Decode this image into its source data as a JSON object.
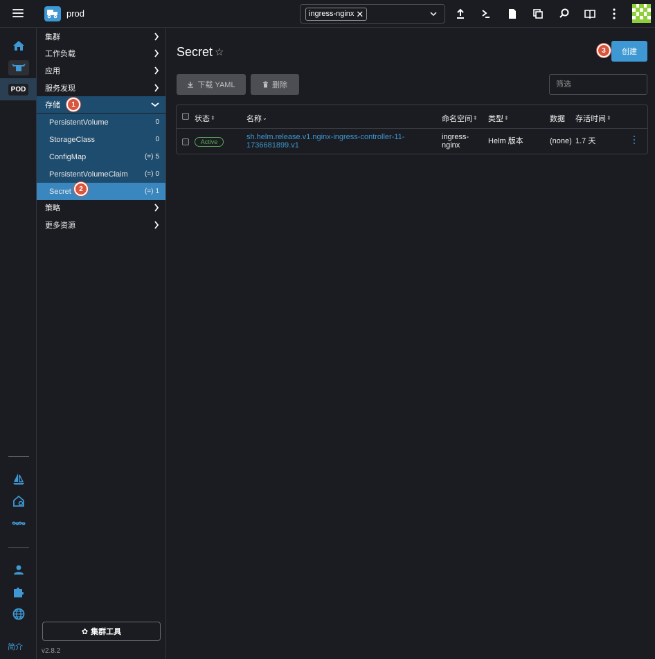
{
  "header": {
    "cluster_name": "prod",
    "namespace_chip": "ingress-nginx",
    "icons": [
      "upload-icon",
      "terminal-icon",
      "file-icon",
      "copy-icon",
      "search-icon",
      "book-icon",
      "kebab-icon"
    ]
  },
  "rail": {
    "pod_label": "POD",
    "bottom_label": "简介"
  },
  "sidenav": {
    "groups": [
      {
        "label": "集群"
      },
      {
        "label": "工作负载"
      },
      {
        "label": "应用"
      },
      {
        "label": "服务发现"
      },
      {
        "label": "存储"
      },
      {
        "label": "策略"
      },
      {
        "label": "更多资源"
      }
    ],
    "storage_items": [
      {
        "label": "PersistentVolume",
        "count": "0"
      },
      {
        "label": "StorageClass",
        "count": "0"
      },
      {
        "label": "ConfigMap",
        "count": "5"
      },
      {
        "label": "PersistentVolumeClaim",
        "count": "0"
      },
      {
        "label": "Secret",
        "count": "1"
      }
    ],
    "callouts": [
      "1",
      "2",
      "3"
    ],
    "cluster_tools": "集群工具",
    "version": "v2.8.2"
  },
  "main": {
    "title": "Secret",
    "create_label": "创建",
    "download_label": "下载 YAML",
    "delete_label": "删除",
    "filter_placeholder": "筛选",
    "columns": [
      "状态",
      "名称",
      "命名空间",
      "类型",
      "数据",
      "存活时间"
    ],
    "rows": [
      {
        "status": "Active",
        "name_line1": "sh.helm.release.v1.nginx-ingress-controller-11-",
        "name_line2": "1736681899.v1",
        "namespace_line1": "ingress-",
        "namespace_line2": "nginx",
        "type": "Helm 版本",
        "data": "(none)",
        "age": "1.7 天"
      }
    ]
  },
  "colors": {
    "accent": "#3d98d3",
    "active_nav": "#3a87c0",
    "open_group": "#1e4c6e",
    "status_green": "#5aa85a",
    "callout": "#d9553d"
  }
}
